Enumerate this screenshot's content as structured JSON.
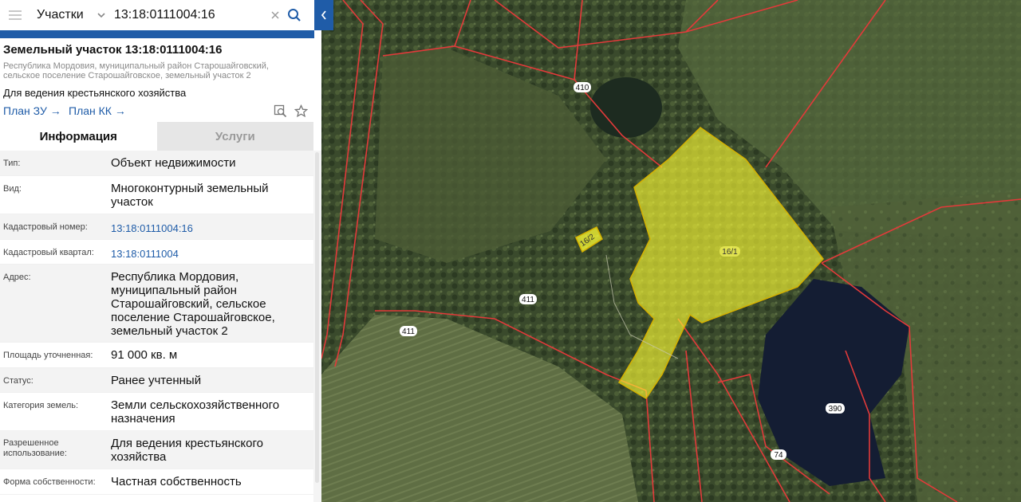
{
  "search": {
    "layer": "Участки",
    "query": "13:18:0111004:16"
  },
  "parcel": {
    "title": "Земельный участок 13:18:0111004:16",
    "address_line1": "Республика Мордовия, муниципальный район Старошайговский,",
    "address_line2": "сельское поселение Старошайговское, земельный участок 2",
    "purpose": "Для ведения крестьянского хозяйства",
    "link_plan_zu": "План ЗУ",
    "link_plan_kk": "План КК",
    "arrow": "→"
  },
  "tabs": {
    "info": "Информация",
    "services": "Услуги"
  },
  "info_rows": {
    "type_label": "Тип:",
    "type_value": "Объект недвижимости",
    "kind_label": "Вид:",
    "kind_value_1": "Многоконтурный земельный",
    "kind_value_2": "участок",
    "cadnum_label": "Кадастровый номер:",
    "cadnum_value": "13:18:0111004:16",
    "quarter_label": "Кадастровый квартал:",
    "quarter_value": "13:18:0111004",
    "address_label": "Адрес:",
    "address_value_1": "Республика Мордовия,",
    "address_value_2": "муниципальный район",
    "address_value_3": "Старошайговский, сельское",
    "address_value_4": "поселение Старошайговское,",
    "address_value_5": "земельный участок 2",
    "area_label": "Площадь уточненная:",
    "area_value": "91 000 кв. м",
    "status_label": "Статус:",
    "status_value": "Ранее учтенный",
    "category_label": "Категория земель:",
    "category_value_1": "Земли сельскохозяйственного",
    "category_value_2": "назначения",
    "usage_label_1": "Разрешенное",
    "usage_label_2": "использование:",
    "usage_value_1": "Для ведения крестьянского",
    "usage_value_2": "хозяйства",
    "ownership_label": "Форма собственности:",
    "ownership_value": "Частная собственность"
  },
  "map_labels": {
    "p410": "410",
    "p411a": "411",
    "p411b": "411",
    "p16_1": "16/1",
    "p16_2": "16/2",
    "p390": "390",
    "p74": "74"
  },
  "colors": {
    "accent": "#1f5ca8",
    "boundary": "#e23a3a",
    "highlight_fill": "#ffff33",
    "highlight_stroke": "#d4b000"
  },
  "icons": {
    "menu": "menu-icon",
    "dropdown": "chevron-down-icon",
    "clear": "close-icon",
    "search": "search-icon",
    "collapse": "chevron-left-icon",
    "zoom_to": "zoom-to-icon",
    "favorite": "star-icon"
  }
}
